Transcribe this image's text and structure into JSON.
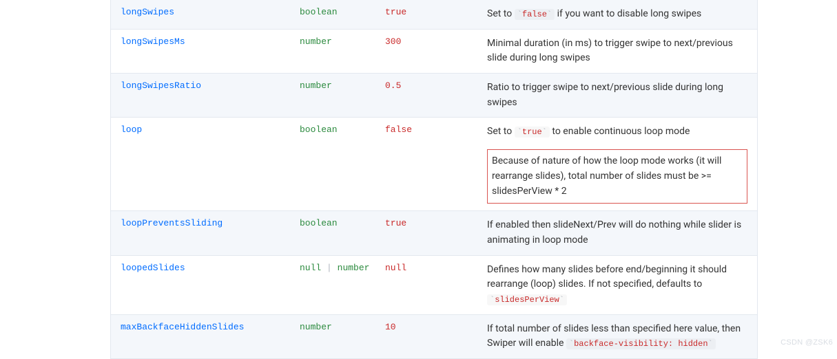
{
  "rows": [
    {
      "name": "longSwipes",
      "type": "boolean",
      "default": "true",
      "desc": [
        {
          "fragments": [
            {
              "t": "text",
              "v": "Set to "
            },
            {
              "t": "code",
              "v": "false"
            },
            {
              "t": "text",
              "v": " if you want to disable long swipes"
            }
          ]
        }
      ]
    },
    {
      "name": "longSwipesMs",
      "type": "number",
      "default": "300",
      "desc": [
        {
          "fragments": [
            {
              "t": "text",
              "v": "Minimal duration (in ms) to trigger swipe to next/previous slide during long swipes"
            }
          ]
        }
      ]
    },
    {
      "name": "longSwipesRatio",
      "type": "number",
      "default": "0.5",
      "desc": [
        {
          "fragments": [
            {
              "t": "text",
              "v": "Ratio to trigger swipe to next/previous slide during long swipes"
            }
          ]
        }
      ]
    },
    {
      "name": "loop",
      "type": "boolean",
      "default": "false",
      "desc": [
        {
          "fragments": [
            {
              "t": "text",
              "v": "Set to "
            },
            {
              "t": "code",
              "v": "true"
            },
            {
              "t": "text",
              "v": " to enable continuous loop mode"
            }
          ]
        },
        {
          "highlight": true,
          "fragments": [
            {
              "t": "text",
              "v": "Because of nature of how the loop mode works (it will rearrange slides), total number of slides must be >= slidesPerView * 2"
            }
          ]
        }
      ]
    },
    {
      "name": "loopPreventsSliding",
      "type": "boolean",
      "default": "true",
      "desc": [
        {
          "fragments": [
            {
              "t": "text",
              "v": "If enabled then slideNext/Prev will do nothing while slider is animating in loop mode"
            }
          ]
        }
      ]
    },
    {
      "name": "loopedSlides",
      "type": "null | number",
      "default": "null",
      "desc": [
        {
          "fragments": [
            {
              "t": "text",
              "v": "Defines how many slides before end/beginning it should rearrange (loop) slides. If not specified, defaults to "
            },
            {
              "t": "code",
              "v": "slidesPerView"
            }
          ]
        }
      ]
    },
    {
      "name": "maxBackfaceHiddenSlides",
      "type": "number",
      "default": "10",
      "desc": [
        {
          "fragments": [
            {
              "t": "text",
              "v": "If total number of slides less than specified here value, then Swiper will enable "
            },
            {
              "t": "code",
              "v": "backface-visibility: hidden"
            }
          ]
        }
      ]
    }
  ],
  "watermark": "CSDN @ZSK6"
}
